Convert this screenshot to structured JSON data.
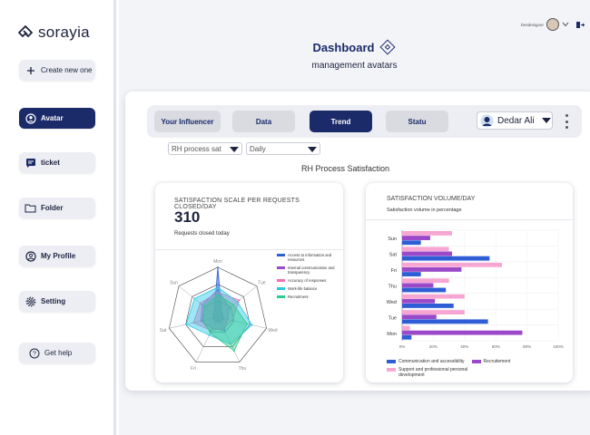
{
  "app": {
    "logo_text": "sorayia"
  },
  "sidebar": {
    "create_label": "Create new one",
    "items": [
      {
        "label": "Avatar",
        "active": true,
        "icon": "user-circle-icon"
      },
      {
        "label": "ticket",
        "active": false,
        "icon": "message-icon"
      },
      {
        "label": "Folder",
        "active": false,
        "icon": "folder-icon"
      },
      {
        "label": "My Profile",
        "active": false,
        "icon": "profile-icon"
      },
      {
        "label": "Setting",
        "active": false,
        "icon": "gear-icon"
      }
    ],
    "help_label": "Get help"
  },
  "header": {
    "username": "Desdesigner",
    "title": "Dashboard",
    "subtitle": "management avatars"
  },
  "tabs": [
    {
      "label": "Your Influencer",
      "active": false
    },
    {
      "label": "Data",
      "active": false
    },
    {
      "label": "Trend",
      "active": true
    },
    {
      "label": "Statu",
      "active": false
    }
  ],
  "user_select": {
    "value": "Dedar Ali"
  },
  "filters": {
    "metric": "RH process sat",
    "period": "Daily"
  },
  "section_title": "RH Process Satisfaction",
  "colors": {
    "navy": "#1b2a69",
    "blue": "#2f5dd6",
    "purple": "#9b49c9",
    "pink": "#f26fb3",
    "light_pink": "#f7a6d3",
    "cyan": "#29c8e6",
    "green": "#2ecc8c"
  },
  "card_left": {
    "title": "SATISFACTION SCALE PER REQUESTS CLOSED/DAY",
    "value": "310",
    "subtitle": "Requests closed today"
  },
  "card_right": {
    "title": "SATISFACTION VOLUME/DAY",
    "subtitle": "Satisfaction volume in percentage"
  },
  "chart_data": [
    {
      "type": "radar",
      "axes": [
        "Mon",
        "Tue",
        "Wed",
        "Thu",
        "Fri",
        "Sat",
        "Sun"
      ],
      "range": [
        0,
        100
      ],
      "legend_position": "right",
      "series": [
        {
          "name": "Access to information and resources",
          "color": "#2f5dd6",
          "values": [
            100,
            10,
            12,
            10,
            10,
            10,
            10
          ]
        },
        {
          "name": "Internal communication and transparency",
          "color": "#9b49c9",
          "values": [
            55,
            30,
            20,
            30,
            25,
            35,
            40
          ]
        },
        {
          "name": "Accuracy of responses",
          "color": "#f26fb3",
          "values": [
            50,
            55,
            30,
            25,
            30,
            50,
            45
          ]
        },
        {
          "name": "Work-life balance",
          "color": "#29c8e6",
          "values": [
            60,
            50,
            70,
            60,
            40,
            65,
            60
          ]
        },
        {
          "name": "Recruitment",
          "color": "#2ecc8c",
          "values": [
            45,
            40,
            60,
            75,
            35,
            30,
            35
          ]
        }
      ]
    },
    {
      "type": "bar",
      "orientation": "horizontal",
      "categories": [
        "Sun",
        "Sat",
        "Fri",
        "Thu",
        "Wed",
        "Tue",
        "Mon"
      ],
      "x_ticks": [
        "0%",
        "20%",
        "40%",
        "60%",
        "80%",
        "100%"
      ],
      "xlim": [
        0,
        100
      ],
      "legend_position": "bottom",
      "series": [
        {
          "name": "Communication and accessibility",
          "color": "#2f5dd6",
          "values": [
            12,
            56,
            12,
            28,
            33,
            55,
            6
          ]
        },
        {
          "name": "Recruitement",
          "color": "#9b49c9",
          "values": [
            18,
            32,
            38,
            20,
            21,
            22,
            77
          ]
        },
        {
          "name": "Support and professional personal development",
          "color": "#f7a6d3",
          "values": [
            32,
            30,
            64,
            30,
            40,
            40,
            5
          ]
        }
      ]
    }
  ]
}
